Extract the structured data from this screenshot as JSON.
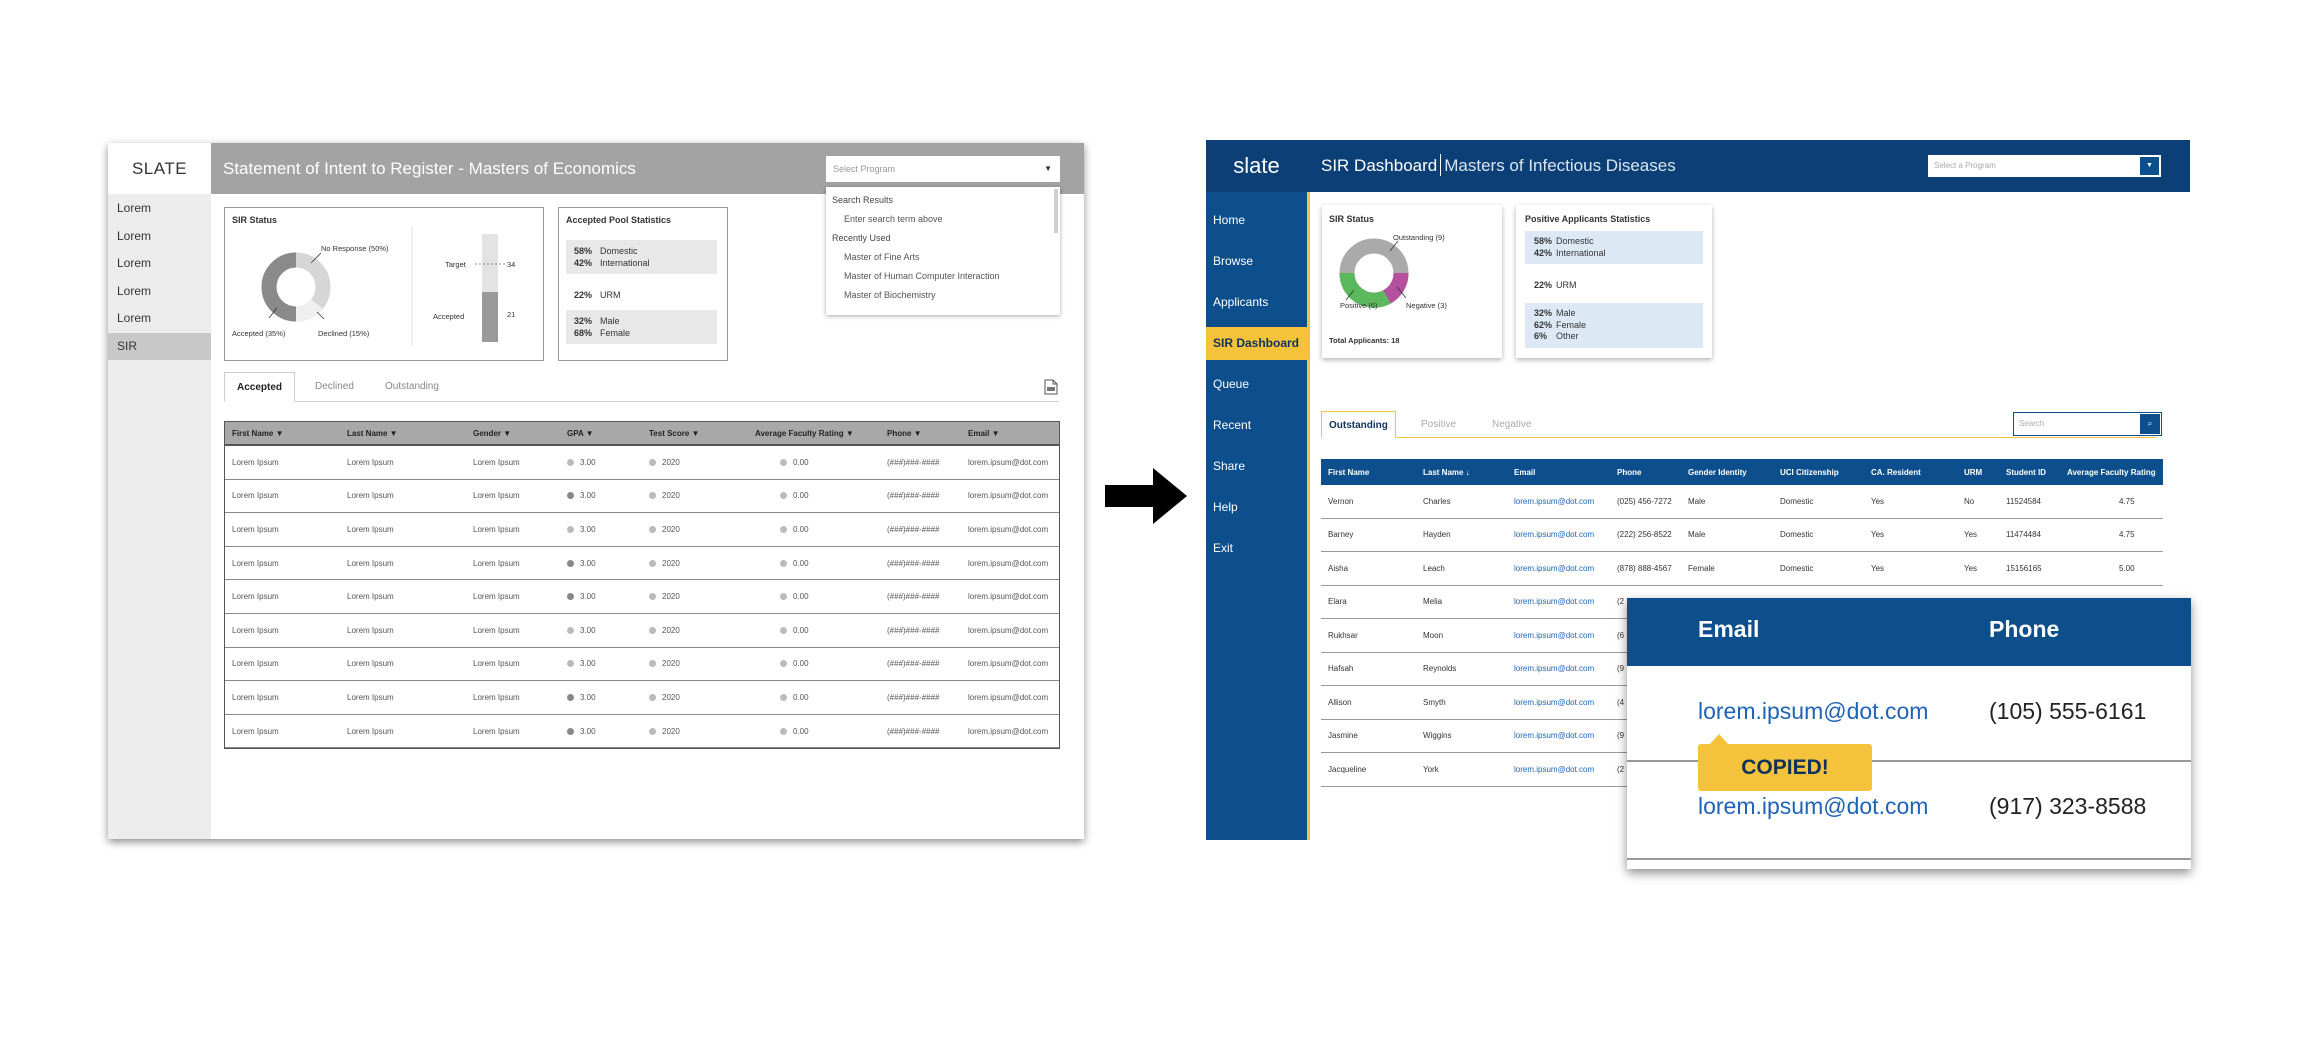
{
  "left": {
    "brand": "SLATE",
    "nav": [
      "Lorem",
      "Lorem",
      "Lorem",
      "Lorem",
      "Lorem",
      "SIR"
    ],
    "title": "Statement of Intent to Register - Masters of Economics",
    "program_select": {
      "placeholder": "Select Program",
      "caret": "▼"
    },
    "dropdown": {
      "search_header": "Search Results",
      "search_hint": "Enter search term above",
      "recent_header": "Recently Used",
      "recent": [
        "Master of Fine Arts",
        "Master of Human Computer Interaction",
        "Master of Biochemistry"
      ]
    },
    "sir_status": {
      "title": "SIR Status",
      "labels": {
        "no_response": "No Response (50%)",
        "accepted": "Accepted (35%)",
        "declined": "Declined (15%)"
      },
      "bar": {
        "target_label": "Target",
        "target_value": "34",
        "accepted_label": "Accepted",
        "accepted_value": "21"
      }
    },
    "pool_stats": {
      "title": "Accepted Pool Statistics",
      "groups": [
        [
          [
            "58%",
            "Domestic"
          ],
          [
            "42%",
            "International"
          ]
        ],
        [
          [
            "22%",
            "URM"
          ]
        ],
        [
          [
            "32%",
            "Male"
          ],
          [
            "68%",
            "Female"
          ]
        ]
      ]
    },
    "tabs": [
      "Accepted",
      "Declined",
      "Outstanding"
    ],
    "export_icon": "csv-file-icon",
    "table": {
      "headers": [
        "First Name ▼",
        "Last Name ▼",
        "Gender ▼",
        "GPA ▼",
        "Test Score ▼",
        "Average Faculty Rating ▼",
        "Phone ▼",
        "Email ▼"
      ],
      "rows": [
        [
          "Lorem Ipsum",
          "Lorem Ipsum",
          "Lorem Ipsum",
          "3.00",
          "2020",
          "0.00",
          "(###)###-####",
          "lorem.ipsum@dot.com"
        ],
        [
          "Lorem Ipsum",
          "Lorem Ipsum",
          "Lorem Ipsum",
          "3.00",
          "2020",
          "0.00",
          "(###)###-####",
          "lorem.ipsum@dot.com"
        ],
        [
          "Lorem Ipsum",
          "Lorem Ipsum",
          "Lorem Ipsum",
          "3.00",
          "2020",
          "0.00",
          "(###)###-####",
          "lorem.ipsum@dot.com"
        ],
        [
          "Lorem Ipsum",
          "Lorem Ipsum",
          "Lorem Ipsum",
          "3.00",
          "2020",
          "0.00",
          "(###)###-####",
          "lorem.ipsum@dot.com"
        ],
        [
          "Lorem Ipsum",
          "Lorem Ipsum",
          "Lorem Ipsum",
          "3.00",
          "2020",
          "0.00",
          "(###)###-####",
          "lorem.ipsum@dot.com"
        ],
        [
          "Lorem Ipsum",
          "Lorem Ipsum",
          "Lorem Ipsum",
          "3.00",
          "2020",
          "0.00",
          "(###)###-####",
          "lorem.ipsum@dot.com"
        ],
        [
          "Lorem Ipsum",
          "Lorem Ipsum",
          "Lorem Ipsum",
          "3.00",
          "2020",
          "0.00",
          "(###)###-####",
          "lorem.ipsum@dot.com"
        ],
        [
          "Lorem Ipsum",
          "Lorem Ipsum",
          "Lorem Ipsum",
          "3.00",
          "2020",
          "0.00",
          "(###)###-####",
          "lorem.ipsum@dot.com"
        ],
        [
          "Lorem Ipsum",
          "Lorem Ipsum",
          "Lorem Ipsum",
          "3.00",
          "2020",
          "0.00",
          "(###)###-####",
          "lorem.ipsum@dot.com"
        ]
      ],
      "gpa_dark": [
        false,
        true,
        false,
        true,
        true,
        false,
        false,
        true,
        true
      ]
    }
  },
  "right": {
    "brand": "slate",
    "nav": [
      "Home",
      "Browse",
      "Applicants",
      "SIR Dashboard",
      "Queue",
      "Recent",
      "Share",
      "Help",
      "Exit"
    ],
    "title": "SIR Dashboard",
    "subtitle": "Masters of Infectious Diseases",
    "program_select": {
      "placeholder": "Select a Program",
      "caret": "▼"
    },
    "sir_status": {
      "title": "SIR Status",
      "labels": {
        "outstanding": "Outstanding (9)",
        "positive": "Positive (6)",
        "negative": "Negative (3)"
      },
      "total": "Total Applicants: 18"
    },
    "pos_stats": {
      "title": "Positive Applicants Statistics",
      "groups": [
        [
          [
            "58%",
            "Domestic"
          ],
          [
            "42%",
            "International"
          ]
        ],
        [
          [
            "22%",
            "URM"
          ]
        ],
        [
          [
            "32%",
            "Male"
          ],
          [
            "62%",
            "Female"
          ],
          [
            "6%",
            "Other"
          ]
        ]
      ]
    },
    "tabs": [
      "Outstanding",
      "Positive",
      "Negative"
    ],
    "search": {
      "placeholder": "Search",
      "icon": "⌕"
    },
    "table": {
      "headers": [
        "First Name",
        "Last Name ↓",
        "Email",
        "Phone",
        "Gender Identity",
        "UCI Citizenship",
        "CA. Resident",
        "URM",
        "Student ID",
        "Average Faculty Rating"
      ],
      "rows": [
        [
          "Vernon",
          "Charles",
          "lorem.ipsum@dot.com",
          "(025) 456-7272",
          "Male",
          "Domestic",
          "Yes",
          "No",
          "11524584",
          "4.75"
        ],
        [
          "Barney",
          "Hayden",
          "lorem.ipsum@dot.com",
          "(222) 256-8522",
          "Male",
          "Domestic",
          "Yes",
          "Yes",
          "11474484",
          "4.75"
        ],
        [
          "Aisha",
          "Leach",
          "lorem.ipsum@dot.com",
          "(878) 888-4567",
          "Female",
          "Domestic",
          "Yes",
          "Yes",
          "15156165",
          "5.00"
        ],
        [
          "Elara",
          "Melia",
          "lorem.ipsum@dot.com",
          "(2"
        ],
        [
          "Rukhsar",
          "Moon",
          "lorem.ipsum@dot.com",
          "(6"
        ],
        [
          "Hafsah",
          "Reynolds",
          "lorem.ipsum@dot.com",
          "(9"
        ],
        [
          "Allison",
          "Smyth",
          "lorem.ipsum@dot.com",
          "(4"
        ],
        [
          "Jasmine",
          "Wiggins",
          "lorem.ipsum@dot.com",
          "(9"
        ],
        [
          "Jacqueline",
          "York",
          "lorem.ipsum@dot.com",
          "(2"
        ]
      ]
    },
    "zoom": {
      "headers": [
        "Email",
        "Phone"
      ],
      "rows": [
        [
          "lorem.ipsum@dot.com",
          "(105) 555-6161"
        ],
        [
          "lorem.ipsum@dot.com",
          "(917) 323-8588"
        ]
      ],
      "toast": "COPIED!"
    }
  },
  "colors": {
    "navy": "#0b3f75",
    "blue": "#0d4e8d",
    "yellow": "#f5c33b",
    "green": "#5cb85c",
    "magenta": "#b5509e",
    "gray": "#a3a3a3"
  },
  "icons": {
    "transition_arrow": "right-arrow-icon"
  }
}
